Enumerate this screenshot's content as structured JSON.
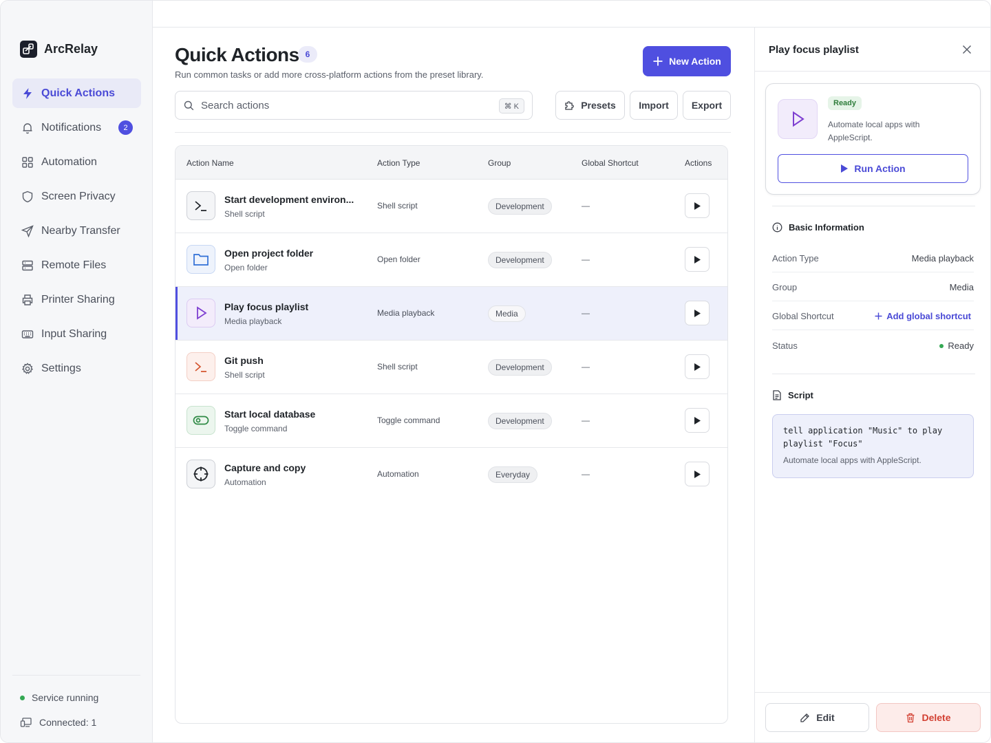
{
  "app": {
    "name": "ArcRelay"
  },
  "sidebar": {
    "items": [
      {
        "label": "Quick Actions",
        "icon": "bolt-icon",
        "active": true
      },
      {
        "label": "Notifications",
        "icon": "bell-icon",
        "badge": "2"
      },
      {
        "label": "Automation",
        "icon": "grid-icon"
      },
      {
        "label": "Screen Privacy",
        "icon": "shield-icon"
      },
      {
        "label": "Nearby Transfer",
        "icon": "send-icon"
      },
      {
        "label": "Remote Files",
        "icon": "server-icon"
      },
      {
        "label": "Printer Sharing",
        "icon": "printer-icon"
      },
      {
        "label": "Input Sharing",
        "icon": "keyboard-icon"
      },
      {
        "label": "Settings",
        "icon": "gear-icon"
      }
    ],
    "status": "Service running",
    "connected": "Connected: 1"
  },
  "main": {
    "title": "Quick Actions",
    "count": "6",
    "subtitle": "Run common tasks or add more cross-platform actions from the preset library.",
    "new_action_label": "New Action",
    "search_placeholder": "Search actions",
    "search_shortcut": "⌘ K",
    "presets_label": "Presets",
    "import_label": "Import",
    "export_label": "Export",
    "columns": [
      "Action Name",
      "Action Type",
      "Group",
      "Global Shortcut",
      "Actions"
    ],
    "rows": [
      {
        "name": "Start development environ...",
        "sub": "Shell script",
        "type": "Shell script",
        "group": "Development",
        "shortcut": "—",
        "icon": "terminal-icon"
      },
      {
        "name": "Open project folder",
        "sub": "Open folder",
        "type": "Open folder",
        "group": "Development",
        "shortcut": "—",
        "icon": "folder-icon"
      },
      {
        "name": "Play focus playlist",
        "sub": "Media playback",
        "type": "Media playback",
        "group": "Media",
        "shortcut": "—",
        "icon": "play-icon",
        "selected": true
      },
      {
        "name": "Git push",
        "sub": "Shell script",
        "type": "Shell script",
        "group": "Development",
        "shortcut": "—",
        "icon": "terminal-icon"
      },
      {
        "name": "Start local database",
        "sub": "Toggle command",
        "type": "Toggle command",
        "group": "Development",
        "shortcut": "—",
        "icon": "toggle-icon"
      },
      {
        "name": "Capture and copy",
        "sub": "Automation",
        "type": "Automation",
        "group": "Everyday",
        "shortcut": "—",
        "icon": "crosshair-icon"
      }
    ]
  },
  "panel": {
    "title": "Play focus playlist",
    "status_pill": "Ready",
    "description": "Automate local apps with AppleScript.",
    "run_label": "Run Action",
    "basic_info_title": "Basic Information",
    "info": {
      "type_key": "Action Type",
      "type_val": "Media playback",
      "group_key": "Group",
      "group_val": "Media",
      "shortcut_key": "Global Shortcut",
      "shortcut_val": "Add global shortcut",
      "status_key": "Status",
      "status_val": "Ready"
    },
    "script_title": "Script",
    "script_code": "tell application \"Music\" to play\nplaylist \"Focus\"",
    "script_note": "Automate local apps with AppleScript.",
    "edit_label": "Edit",
    "delete_label": "Delete"
  },
  "colors": {
    "accent": "#4f4fe0",
    "danger": "#d23f31",
    "success": "#34a853"
  }
}
